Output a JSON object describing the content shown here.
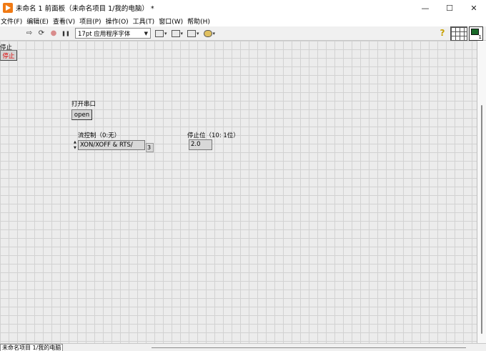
{
  "window": {
    "title": "未命名 1 前面板（未命名项目 1/我的电脑） *",
    "minimize_glyph": "—",
    "maximize_glyph": "☐",
    "close_glyph": "✕"
  },
  "menu": {
    "items": [
      "文件(F)",
      "编辑(E)",
      "查看(V)",
      "项目(P)",
      "操作(O)",
      "工具(T)",
      "窗口(W)",
      "帮助(H)"
    ]
  },
  "toolbar": {
    "run_icon": "⇨",
    "run_continuous_icon": "⟳",
    "abort_icon": "●",
    "pause_icon": "❚❚",
    "font_select_value": "17pt 应用程序字体",
    "help_glyph": "?",
    "vi_icon_number": "1"
  },
  "panel": {
    "stop_label": "停止",
    "stop_button_text": "停止",
    "open_label": "打开串口",
    "open_button_text": "open",
    "flow_label": "流控制（0:无）",
    "flow_value": "XON/XOFF & RTS/",
    "flow_index": "3",
    "stopbits_label": "停止位（10: 1位）",
    "stopbits_value": "2.0"
  },
  "status": {
    "context": "未命名项目 1/我的电脑"
  },
  "colors": {
    "stop_text": "#e00000",
    "app_icon": "#f07a14"
  }
}
